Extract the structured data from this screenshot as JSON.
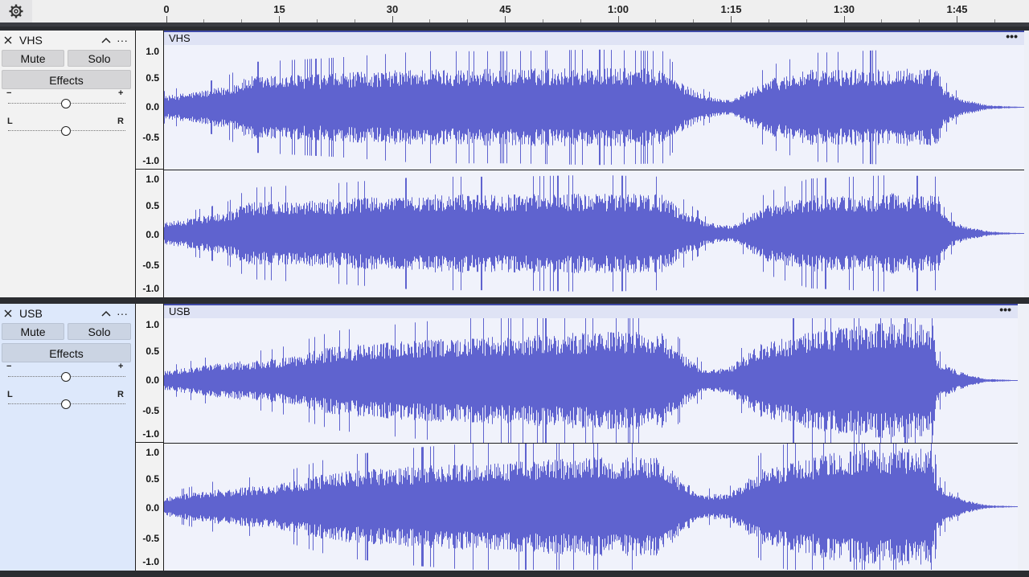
{
  "ruler": {
    "settings_icon": "gear-icon",
    "labels": [
      "0",
      "15",
      "30",
      "45",
      "1:00",
      "1:15",
      "1:30",
      "1:45"
    ]
  },
  "tracks": [
    {
      "name": "VHS",
      "clip_name": "VHS",
      "mute_label": "Mute",
      "solo_label": "Solo",
      "effects_label": "Effects",
      "gain_minus": "−",
      "gain_plus": "+",
      "pan_left": "L",
      "pan_right": "R",
      "selected": false,
      "more_label": "···",
      "clip_more_label": "•••"
    },
    {
      "name": "USB",
      "clip_name": "USB",
      "mute_label": "Mute",
      "solo_label": "Solo",
      "effects_label": "Effects",
      "gain_minus": "−",
      "gain_plus": "+",
      "pan_left": "L",
      "pan_right": "R",
      "selected": true,
      "more_label": "···",
      "clip_more_label": "•••"
    }
  ],
  "amplitude_labels": [
    "1.0",
    "0.5",
    "0.0",
    "-0.5",
    "-1.0"
  ],
  "colors": {
    "waveform": "#5f63cf",
    "clip_background": "#f0f2fb",
    "clip_header_border": "#3f4aa8"
  }
}
